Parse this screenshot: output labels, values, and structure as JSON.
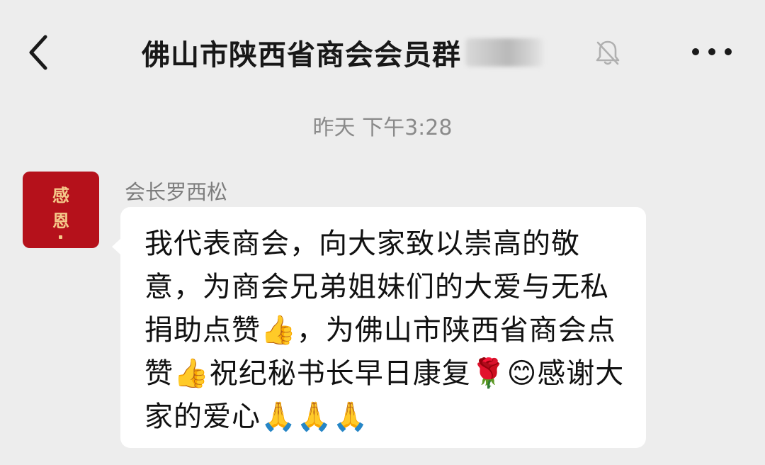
{
  "header": {
    "title": "佛山市陕西省商会会员群",
    "back_icon": "chevron-left-icon",
    "mute_icon": "bell-slash-icon",
    "more_icon": "ellipsis-icon"
  },
  "chat": {
    "timestamp": "昨天 下午3:28",
    "messages": [
      {
        "sender": "会长罗西松",
        "avatar_text": [
          "感",
          "恩"
        ],
        "text": "我代表商会，向大家致以崇高的敬意，为商会兄弟姐妹们的大爱与无私捐助点赞👍，为佛山市陕西省商会点赞👍祝纪秘书长早日康复🌹😊感谢大家的爱心🙏🙏🙏"
      }
    ]
  },
  "colors": {
    "background": "#ededed",
    "bubble": "#ffffff",
    "avatar_bg": "#b5111b",
    "avatar_text": "#f5c98a",
    "muted_text": "#8a8a8a"
  }
}
